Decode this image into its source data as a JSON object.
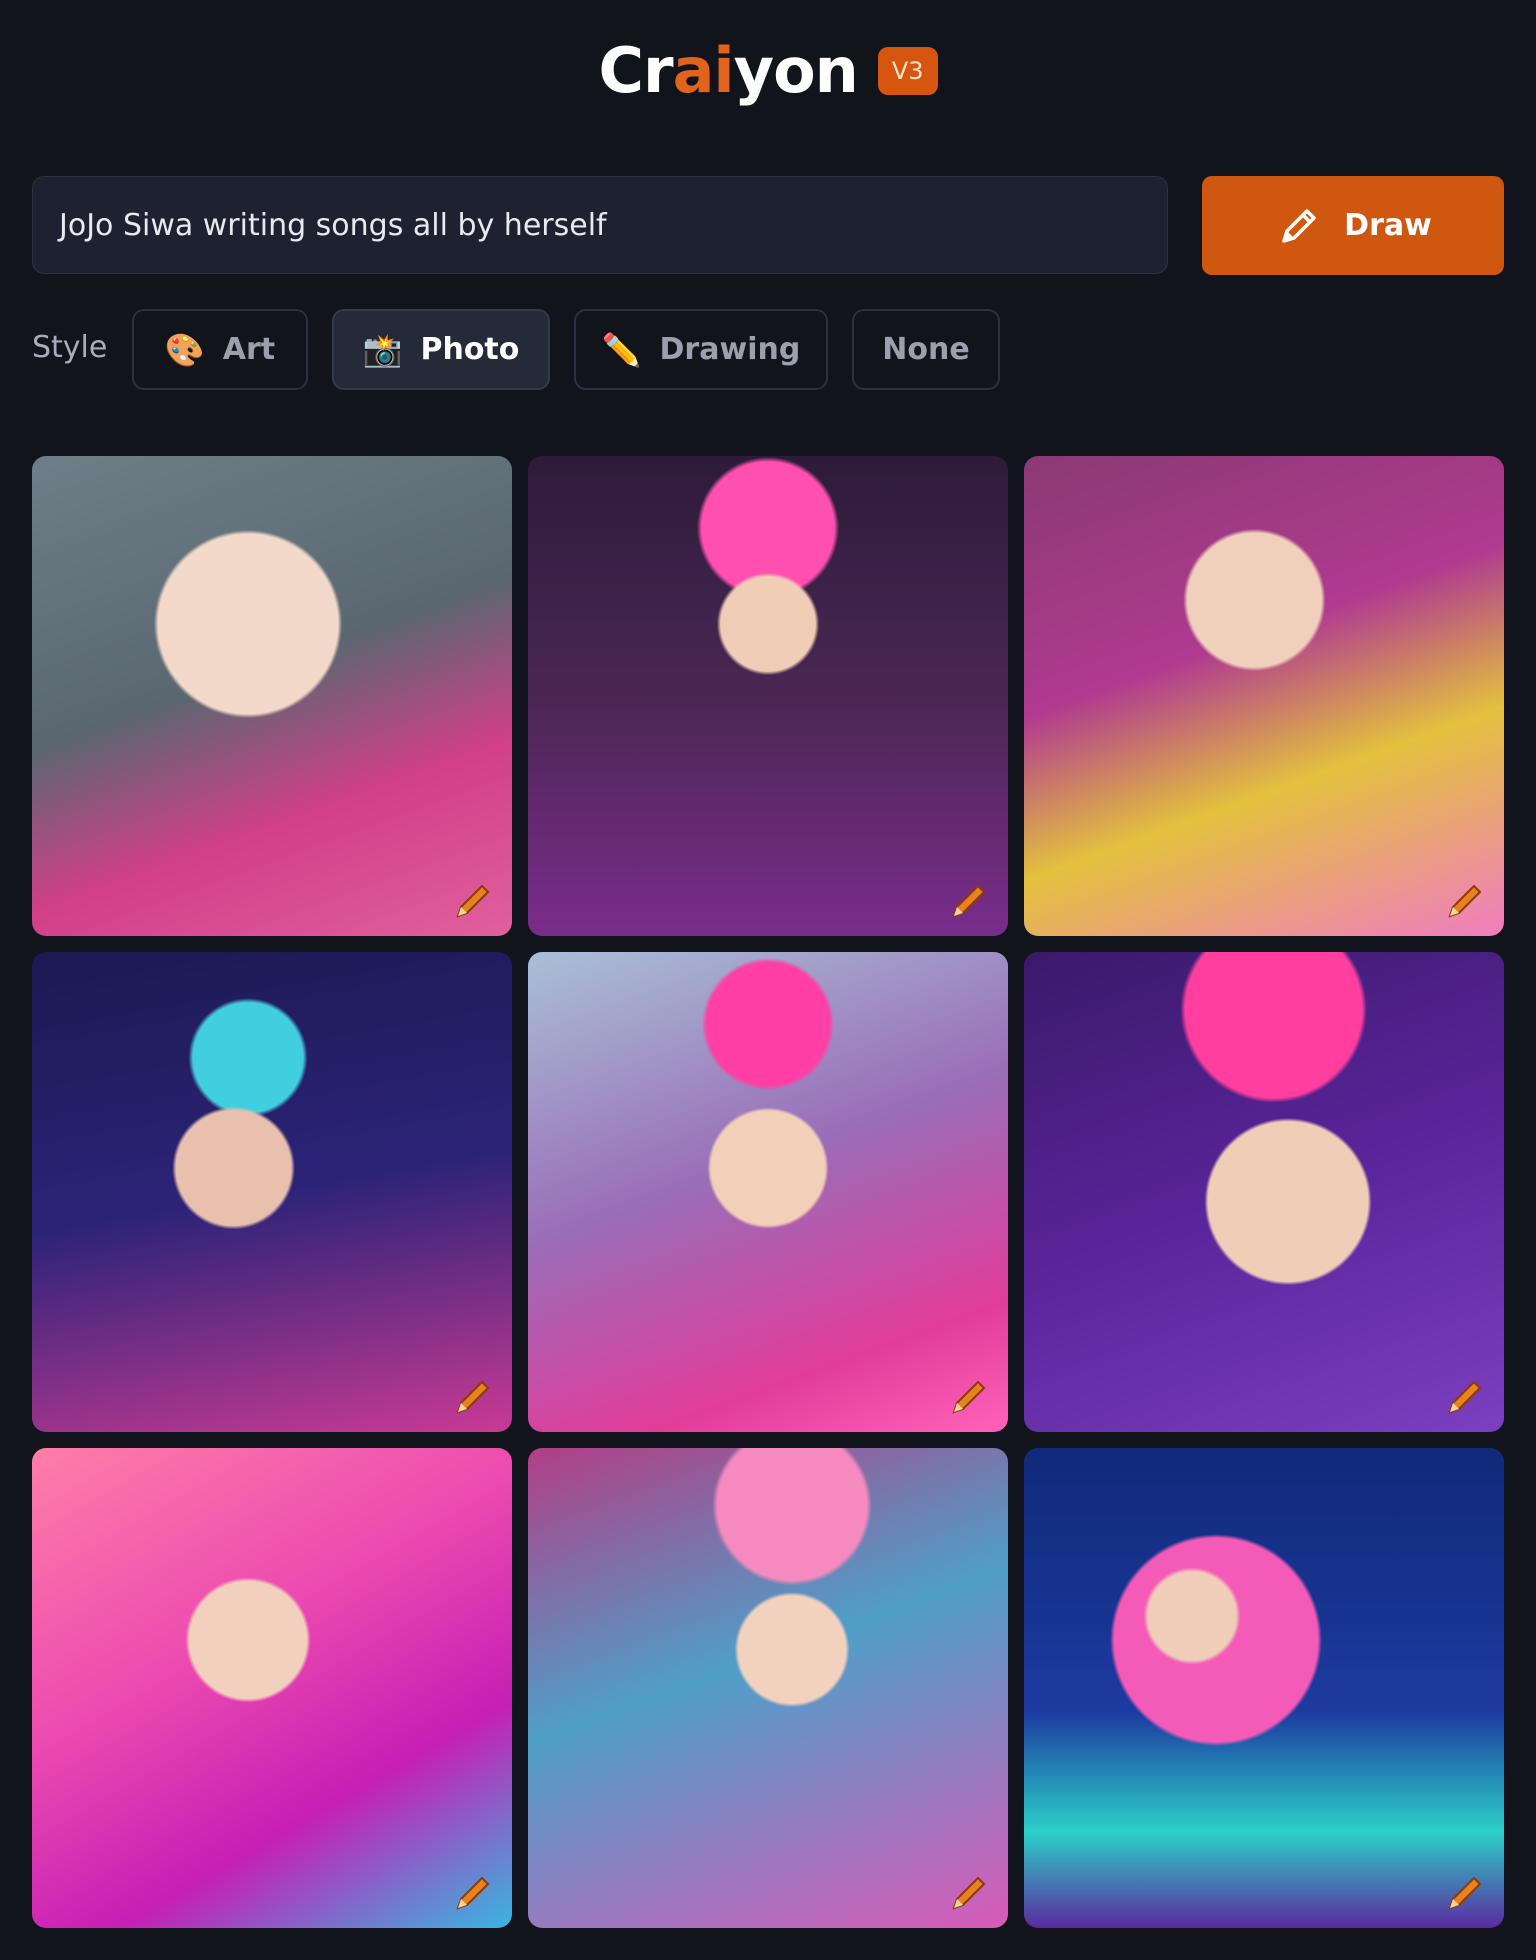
{
  "header": {
    "logo_part1": "Cr",
    "logo_accent": "ai",
    "logo_part2": "yon",
    "version_badge": "V3"
  },
  "prompt": {
    "value": "JoJo Siwa writing songs all by herself"
  },
  "draw_button": {
    "label": "Draw",
    "icon": "pencil-icon",
    "color": "#d0570f"
  },
  "style": {
    "label": "Style",
    "options": [
      {
        "label": "Art",
        "icon": "🎨",
        "selected": false
      },
      {
        "label": "Photo",
        "icon": "📸",
        "selected": true
      },
      {
        "label": "Drawing",
        "icon": "✏️",
        "selected": false
      },
      {
        "label": "None",
        "icon": "",
        "selected": false
      }
    ]
  },
  "results": {
    "images": [
      {
        "description": "image-1",
        "edit_icon": "pencil-icon"
      },
      {
        "description": "image-2",
        "edit_icon": "pencil-icon"
      },
      {
        "description": "image-3",
        "edit_icon": "pencil-icon"
      },
      {
        "description": "image-4",
        "edit_icon": "pencil-icon"
      },
      {
        "description": "image-5",
        "edit_icon": "pencil-icon"
      },
      {
        "description": "image-6",
        "edit_icon": "pencil-icon"
      },
      {
        "description": "image-7",
        "edit_icon": "pencil-icon"
      },
      {
        "description": "image-8",
        "edit_icon": "pencil-icon"
      },
      {
        "description": "image-9",
        "edit_icon": "pencil-icon"
      }
    ]
  },
  "colors": {
    "background": "#12141c",
    "accent": "#e0641c"
  }
}
